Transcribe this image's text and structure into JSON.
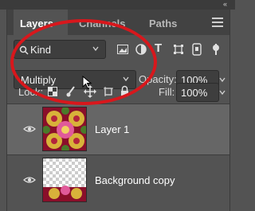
{
  "tabs": [
    {
      "label": "Layers",
      "active": true
    },
    {
      "label": "Channels",
      "active": false
    },
    {
      "label": "Paths",
      "active": false
    }
  ],
  "filter": {
    "kind_label": "Kind"
  },
  "blend_mode": {
    "value": "Multiply"
  },
  "opacity": {
    "label": "Opacity:",
    "value": "100%"
  },
  "lock": {
    "label": "Lock:"
  },
  "fill": {
    "label": "Fill:",
    "value": "100%"
  },
  "layers": [
    {
      "name": "Layer 1",
      "selected": true
    },
    {
      "name": "Background copy",
      "selected": false
    }
  ],
  "colors": {
    "highlight_circle": "#d8171c",
    "panel": "#535353",
    "selected_row": "#666666"
  }
}
